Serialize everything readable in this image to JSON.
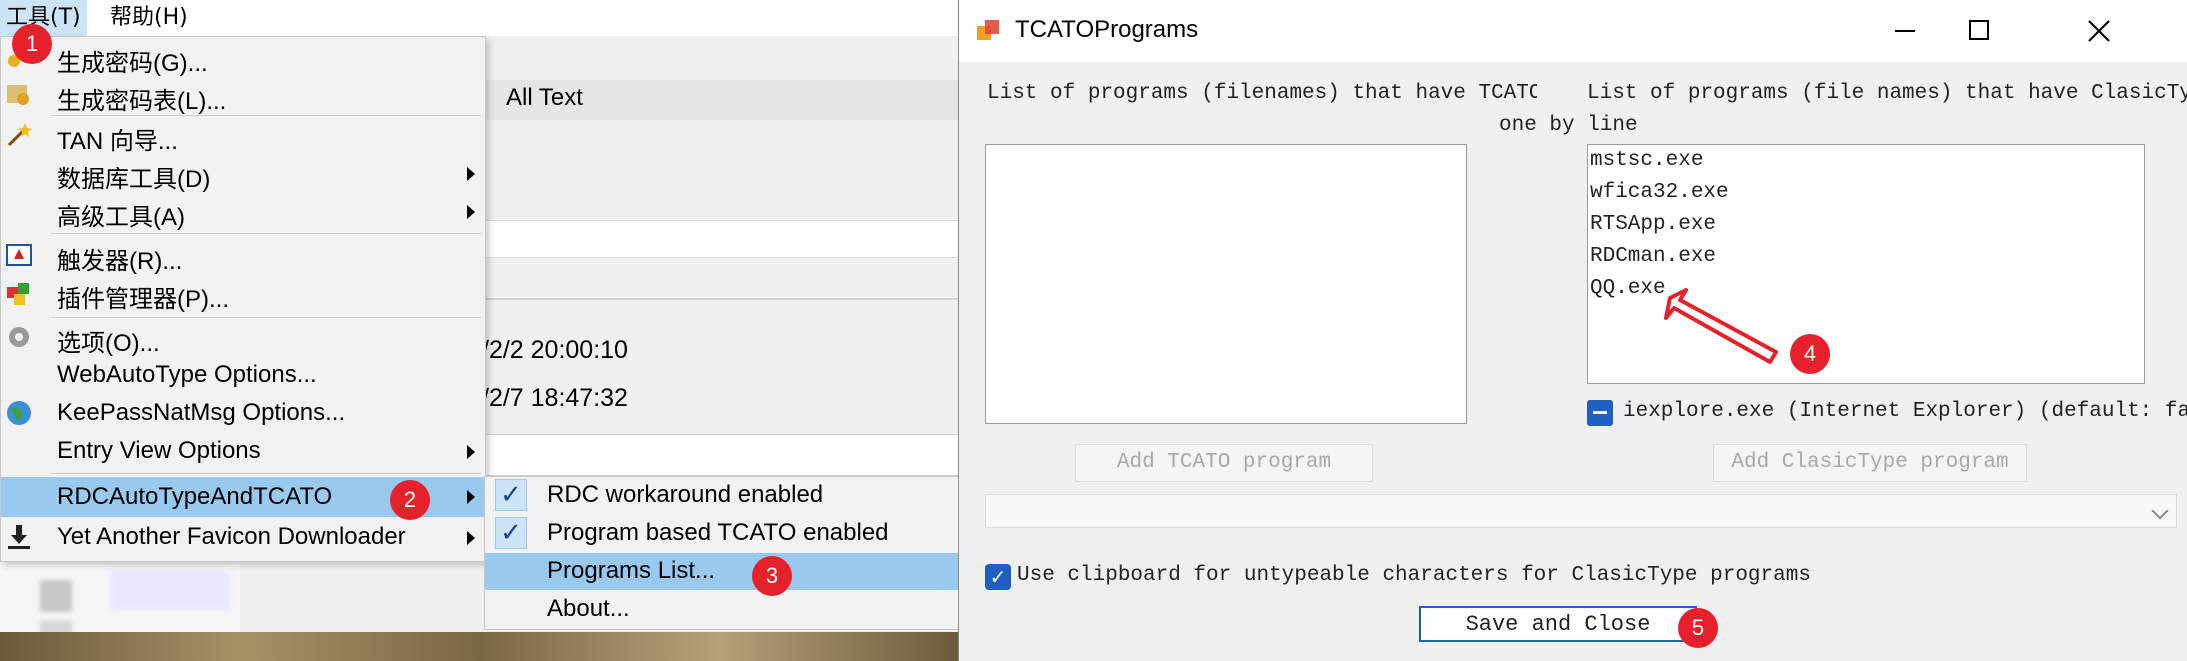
{
  "menubar": {
    "tools_label": "工具(T)",
    "help_label": "帮助(H)"
  },
  "background": {
    "toolbar_text": "All Text",
    "date1": "/2/2 20:00:10",
    "date2": "/2/7 18:47:32"
  },
  "dropdown": {
    "items": [
      {
        "label": "生成密码(G)...",
        "icon": "key-icon"
      },
      {
        "label": "生成密码表(L)...",
        "icon": "key-list-icon"
      },
      {
        "label": "TAN 向导...",
        "icon": "wand-icon"
      },
      {
        "label": "数据库工具(D)",
        "icon": "",
        "submenu": true
      },
      {
        "label": "高级工具(A)",
        "icon": "",
        "submenu": true
      },
      {
        "label": "触发器(R)...",
        "icon": "trigger-icon"
      },
      {
        "label": "插件管理器(P)...",
        "icon": "plugin-icon"
      },
      {
        "label": "选项(O)...",
        "icon": "gear-icon"
      },
      {
        "label": "WebAutoType Options...",
        "icon": ""
      },
      {
        "label": "KeePassNatMsg Options...",
        "icon": "globe-icon"
      },
      {
        "label": "Entry View Options",
        "icon": "",
        "submenu": true
      },
      {
        "label": "RDCAutoTypeAndTCATO",
        "icon": "",
        "submenu": true
      },
      {
        "label": "Yet Another Favicon Downloader",
        "icon": "download-icon",
        "submenu": true
      }
    ]
  },
  "submenu": {
    "items": [
      {
        "label": "RDC workaround enabled",
        "checked": true
      },
      {
        "label": "Program based TCATO enabled",
        "checked": true
      },
      {
        "label": "Programs List...",
        "checked": false
      },
      {
        "label": "About...",
        "checked": false
      }
    ]
  },
  "badges": [
    "1",
    "2",
    "3",
    "4",
    "5"
  ],
  "dialog": {
    "title": "TCATOPrograms",
    "tcato_list_label": "List of programs (filenames) that have TCATO enabl",
    "clasic_list_label": "List of programs (file names) that have ClasicType",
    "clasic_list_label_2": "one by line",
    "tcato_programs": [],
    "clasic_programs": [
      "mstsc.exe",
      "wfica32.exe",
      "RTSApp.exe",
      "RDCman.exe",
      "QQ.exe"
    ],
    "iexplore_label": "iexplore.exe (Internet Explorer) (default: false",
    "add_tcato_label": "Add TCATO program",
    "add_clasic_label": "Add ClasicType program",
    "clipboard_label": "Use clipboard for untypeable characters for ClasicType programs",
    "save_label": "Save and Close"
  },
  "colors": {
    "accent": "#1f5fbf",
    "badge": "#e6212b",
    "menu_highlight": "#99c9ef"
  }
}
